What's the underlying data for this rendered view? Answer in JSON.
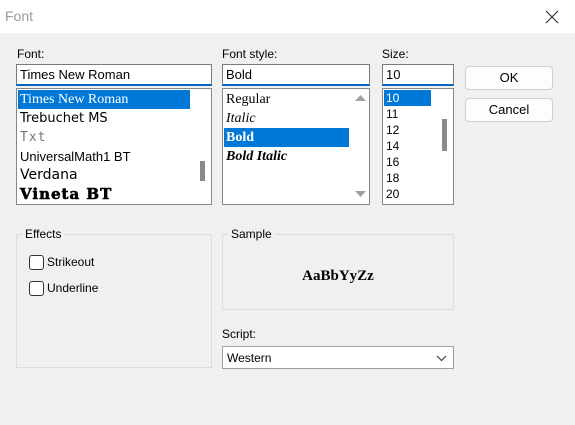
{
  "window": {
    "title": "Font"
  },
  "font": {
    "label": "Font:",
    "value": "Times New Roman",
    "items": [
      "Times New Roman",
      "Trebuchet MS",
      "Txt",
      "UniversalMath1 BT",
      "Verdana",
      "Vineta BT"
    ],
    "selected_index": 0
  },
  "font_style": {
    "label": "Font style:",
    "value": "Bold",
    "items": [
      "Regular",
      "Italic",
      "Bold",
      "Bold Italic"
    ],
    "selected_index": 2
  },
  "size": {
    "label": "Size:",
    "value": "10",
    "items": [
      "10",
      "11",
      "12",
      "14",
      "16",
      "18",
      "20"
    ],
    "selected_index": 0
  },
  "buttons": {
    "ok": "OK",
    "cancel": "Cancel"
  },
  "effects": {
    "label": "Effects",
    "strikeout": "Strikeout",
    "strikeout_checked": false,
    "underline": "Underline",
    "underline_checked": false
  },
  "sample": {
    "label": "Sample",
    "text": "AaBbYyZz"
  },
  "script": {
    "label": "Script:",
    "value": "Western"
  },
  "colors": {
    "selection": "#0078d7",
    "focus_border": "#0067c0",
    "title_text": "#9a9a9a"
  }
}
